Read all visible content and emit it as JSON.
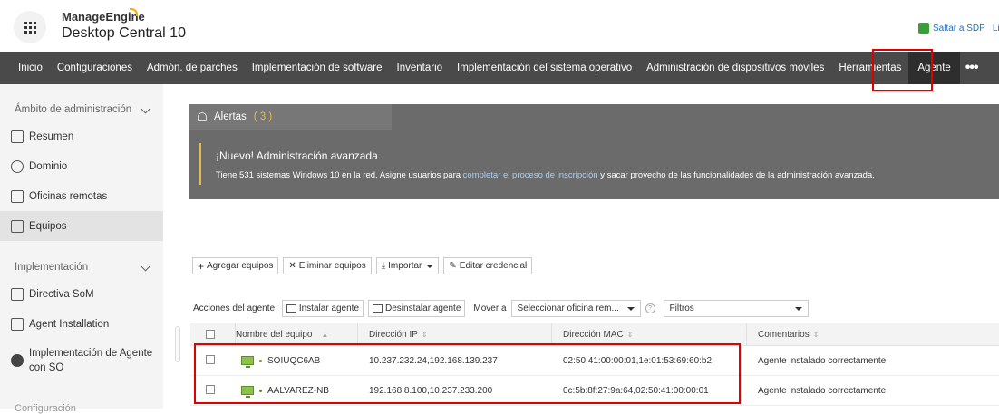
{
  "brand": {
    "top": "ManageEngine",
    "main": "Desktop Central 10"
  },
  "header": {
    "sdp_link": "Saltar a SDP",
    "sdp_cut": "Li"
  },
  "nav": {
    "items": [
      "Inicio",
      "Configuraciones",
      "Admón. de parches",
      "Implementación de software",
      "Inventario",
      "Implementación del sistema operativo",
      "Administración de dispositivos móviles",
      "Herramientas"
    ],
    "active": "Agente",
    "more": "•••"
  },
  "sidebar": {
    "section1": "Ámbito de administración",
    "items1": [
      "Resumen",
      "Dominio",
      "Oficinas remotas",
      "Equipos"
    ],
    "section2": "Implementación",
    "items2": [
      "Directiva SoM",
      "Agent Installation",
      "Implementación de Agente con SO"
    ],
    "faded": "Configuración"
  },
  "alerts": {
    "tab_label": "Alertas",
    "count": "( 3 )",
    "title": "¡Nuevo! Administración avanzada",
    "text_before": "Tiene 531 sistemas Windows 10 en la red. Asigne usuarios para ",
    "link": "completar el proceso de inscripción",
    "text_after": " y sacar provecho de las funcionalidades de la administración avanzada."
  },
  "toolbar": {
    "add": "Agregar equipos",
    "remove": "Eliminar equipos",
    "import": "Importar",
    "edit": "Editar credencial"
  },
  "actions": {
    "label": "Acciones del agente:",
    "install": "Instalar agente",
    "uninstall": "Desinstalar agente",
    "move_label": "Mover a",
    "office_select": "Seleccionar oficina rem...",
    "filters": "Filtros"
  },
  "table": {
    "headers": {
      "name": "Nombre del equipo",
      "ip": "Dirección IP",
      "mac": "Dirección MAC",
      "comments": "Comentarios"
    },
    "rows": [
      {
        "name": "SOIUQC6AB",
        "ip": "10.237.232.24,192.168.139.237",
        "mac": "02:50:41:00:00:01,1e:01:53:69:60:b2",
        "comment": "Agente instalado correctamente"
      },
      {
        "name": "AALVAREZ-NB",
        "ip": "192.168.8.100,10.237.233.200",
        "mac": "0c:5b:8f:27:9a:64,02:50:41:00:00:01",
        "comment": "Agente instalado correctamente"
      }
    ]
  },
  "colors": {
    "nav_bg": "#4a4a4a",
    "highlight": "#e00000",
    "alert_bg": "#6b6b6b",
    "alert_accent": "#e7b84a",
    "link": "#9fd1ff"
  }
}
